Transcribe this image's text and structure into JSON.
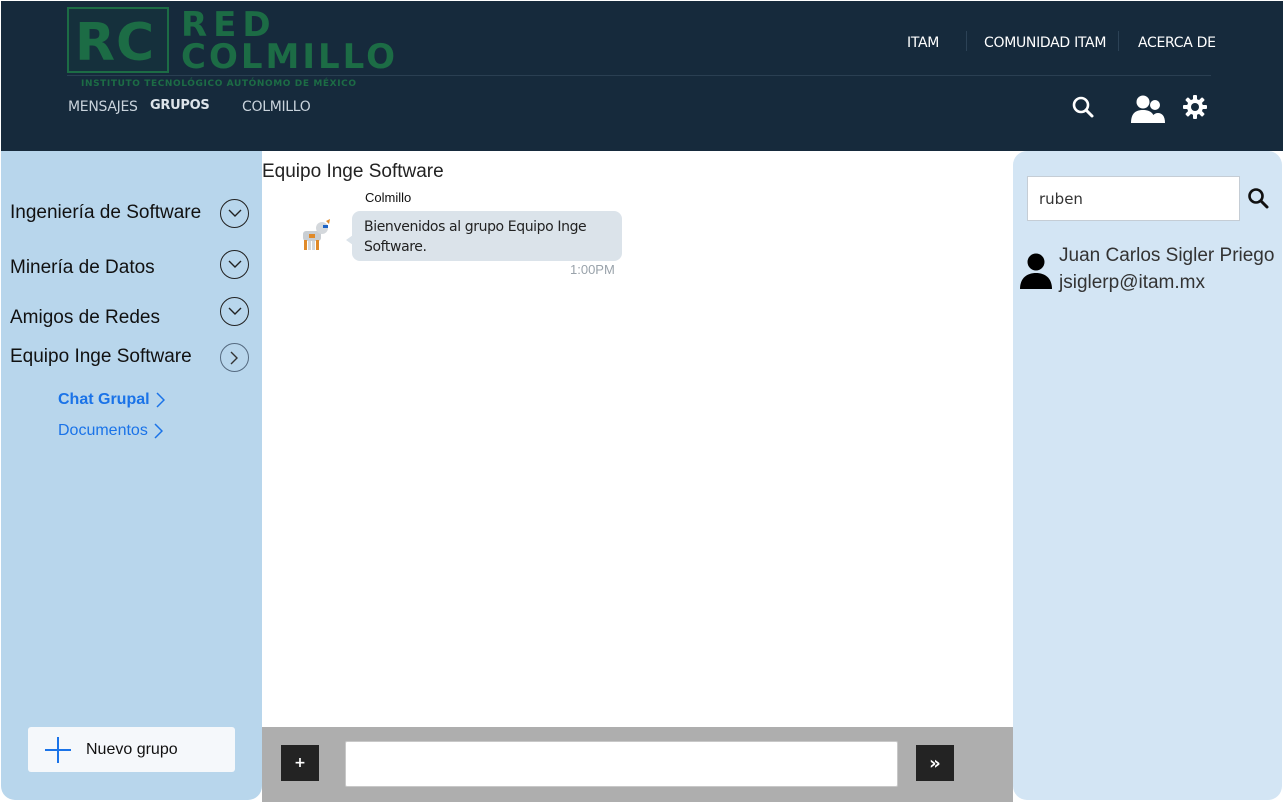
{
  "brand": {
    "logo_initials": "RC",
    "logo_word1": "RED",
    "logo_word2": "COLMILLO",
    "logo_tagline": "INSTITUTO TECNOLÓGICO AUTÓNOMO DE MÉXICO",
    "logo_color": "#1c6c45"
  },
  "top_nav": {
    "items": [
      {
        "label": "ITAM"
      },
      {
        "label": "COMUNIDAD ITAM"
      },
      {
        "label": "ACERCA DE"
      }
    ]
  },
  "sub_nav": {
    "items": [
      {
        "label": "MENSAJES"
      },
      {
        "label": "GRUPOS"
      },
      {
        "label": "COLMILLO"
      }
    ],
    "active": "GRUPOS"
  },
  "header_icons": [
    "search-icon",
    "users-icon",
    "gear-icon"
  ],
  "sidebar": {
    "groups": [
      {
        "label": "Ingeniería de Software",
        "icon": "chevron-down-icon"
      },
      {
        "label": "Minería de Datos",
        "icon": "chevron-down-icon"
      },
      {
        "label": "Amigos de Redes",
        "icon": "chevron-down-icon"
      },
      {
        "label": "Equipo Inge Software",
        "icon": "chevron-right-icon"
      }
    ],
    "subitems": [
      {
        "label": "Chat Grupal",
        "active": true
      },
      {
        "label": "Documentos",
        "active": false
      }
    ],
    "new_group_label": "Nuevo grupo"
  },
  "chat": {
    "title": "Equipo Inge Software",
    "messages": [
      {
        "sender": "Colmillo",
        "text": "Bienvenidos al grupo Equipo Inge Software.",
        "time": "1:00PM"
      }
    ],
    "composer": {
      "attach_label": "+",
      "send_label": "»",
      "value": ""
    }
  },
  "people_search": {
    "query": "ruben",
    "results": [
      {
        "name": "Juan Carlos Sigler Priego",
        "email": "jsiglerp@itam.mx"
      }
    ]
  },
  "colors": {
    "header_bg": "#162a3c",
    "sidebar_bg": "#b8d6ec",
    "right_panel_bg": "#d3e5f4",
    "link": "#1a73e8",
    "composer_bg": "#aeaeae"
  }
}
